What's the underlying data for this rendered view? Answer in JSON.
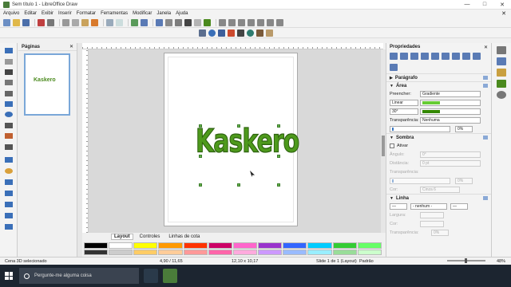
{
  "window": {
    "title": "Sem título 1 - LibreOffice Draw",
    "minimize": "—",
    "maximize": "□",
    "close": "✕"
  },
  "menu": [
    "Arquivo",
    "Editar",
    "Exibir",
    "Inserir",
    "Formatar",
    "Ferramentas",
    "Modificar",
    "Janela",
    "Ajuda"
  ],
  "pages_panel": {
    "title": "Páginas",
    "close": "✕",
    "thumbnail_text": "Kaskero"
  },
  "canvas": {
    "text_object": "Kaskero"
  },
  "tabs": [
    "Layout",
    "Controles",
    "Linhas de cota"
  ],
  "palette_colors": [
    "#000000",
    "#ffffff",
    "#ffff00",
    "#ff9900",
    "#ff3300",
    "#cc0066",
    "#ff66cc",
    "#9933cc",
    "#3366ff",
    "#00ccff",
    "#33cc33",
    "#66ff66",
    "#333333",
    "#cccccc",
    "#ffcc66",
    "#ffcc99",
    "#ff9999",
    "#ff66aa",
    "#ffaadd",
    "#cc99ff",
    "#99bbff",
    "#99eeff",
    "#99dd99",
    "#ccffcc"
  ],
  "sidebar": {
    "title": "Propriedades",
    "close": "✕",
    "sections": {
      "paragraph": "Parágrafo",
      "area": "Área",
      "shadow": "Sombra",
      "line": "Linha"
    },
    "area": {
      "fill_label": "Preencher:",
      "fill_value": "Gradiente",
      "gradient_type": "Linear",
      "gradient_color1": "#66cc33",
      "gradient_color2": "#338800",
      "angle_value": "30°",
      "transparency_label": "Transparência:",
      "transparency_value": "Nenhuma",
      "transparency_pct": "0%"
    },
    "shadow": {
      "enable_label": "Ativar",
      "angle_label": "Ângulo:",
      "angle_value": "0°",
      "distance_label": "Distância:",
      "distance_value": "0 pt",
      "transparency_label": "Transparência:",
      "transparency_pct": "0%",
      "color_label": "Cor:",
      "color_value": "Cinza 6"
    },
    "line": {
      "style_value": "- nenhum -",
      "width_label": "Largura:",
      "color_label": "Cor:",
      "transparency_label": "Transparência:",
      "transparency_pct": "0%"
    }
  },
  "status": {
    "selection": "Cena 3D selecionado",
    "position": "4,90 / 11,65",
    "size": "12,10 x 10,17",
    "page": "Slide 1 de 1 (Layout)",
    "style": "Padrão",
    "zoom": "48%"
  },
  "taskbar": {
    "search_placeholder": "Pergunte-me alguma coisa"
  }
}
